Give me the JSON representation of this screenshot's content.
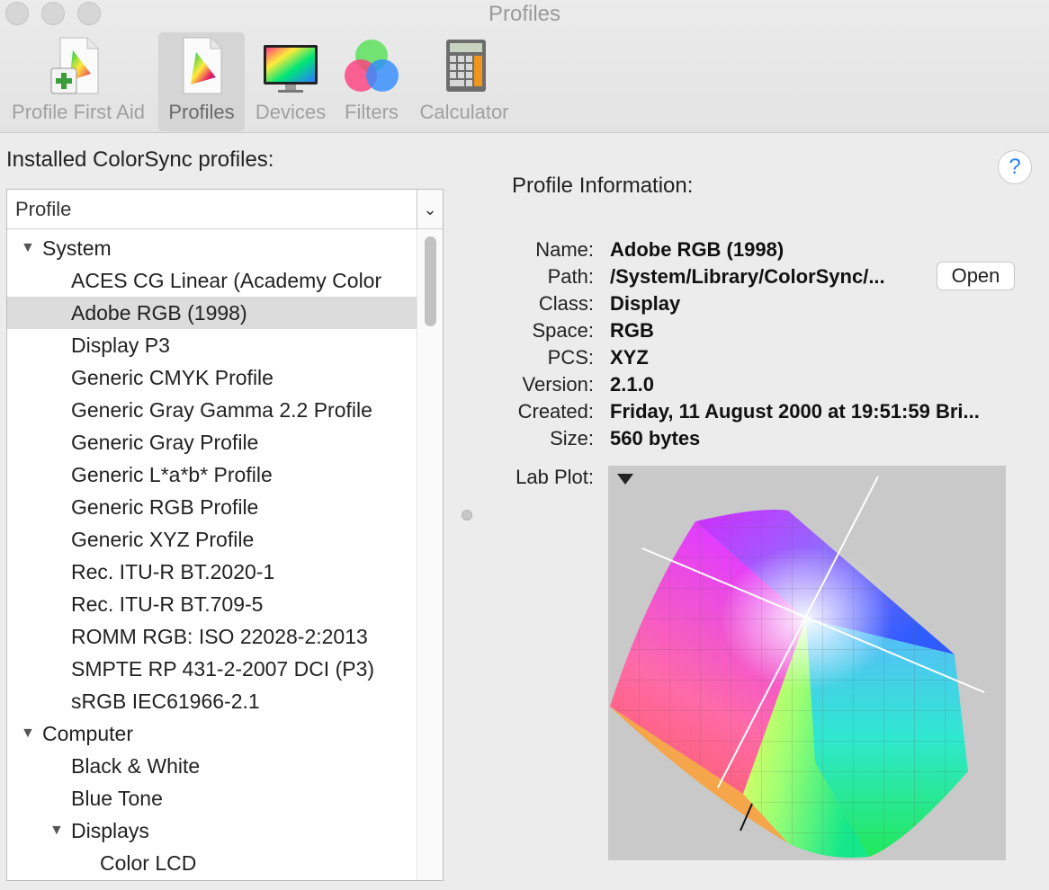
{
  "window": {
    "title": "Profiles"
  },
  "toolbar": {
    "items": [
      {
        "label": "Profile First Aid",
        "icon": "profile-first-aid-icon"
      },
      {
        "label": "Profiles",
        "icon": "profiles-icon",
        "active": true
      },
      {
        "label": "Devices",
        "icon": "devices-icon"
      },
      {
        "label": "Filters",
        "icon": "filters-icon"
      },
      {
        "label": "Calculator",
        "icon": "calculator-icon"
      }
    ]
  },
  "left": {
    "installed_label": "Installed ColorSync profiles:",
    "column_header": "Profile",
    "rows": [
      {
        "label": "System",
        "level": 0,
        "group": true,
        "expanded": true
      },
      {
        "label": "ACES CG Linear (Academy Color",
        "level": 1
      },
      {
        "label": "Adobe RGB (1998)",
        "level": 1,
        "selected": true
      },
      {
        "label": "Display P3",
        "level": 1
      },
      {
        "label": "Generic CMYK Profile",
        "level": 1
      },
      {
        "label": "Generic Gray Gamma 2.2 Profile",
        "level": 1
      },
      {
        "label": "Generic Gray Profile",
        "level": 1
      },
      {
        "label": "Generic L*a*b* Profile",
        "level": 1
      },
      {
        "label": "Generic RGB Profile",
        "level": 1
      },
      {
        "label": "Generic XYZ Profile",
        "level": 1
      },
      {
        "label": "Rec. ITU-R BT.2020-1",
        "level": 1
      },
      {
        "label": "Rec. ITU-R BT.709-5",
        "level": 1
      },
      {
        "label": "ROMM RGB: ISO 22028-2:2013",
        "level": 1
      },
      {
        "label": "SMPTE RP 431-2-2007 DCI (P3)",
        "level": 1
      },
      {
        "label": "sRGB IEC61966-2.1",
        "level": 1
      },
      {
        "label": "Computer",
        "level": 0,
        "group": true,
        "expanded": true
      },
      {
        "label": "Black & White",
        "level": 1
      },
      {
        "label": "Blue Tone",
        "level": 1
      },
      {
        "label": "Displays",
        "level": 1,
        "group": true,
        "expanded": true
      },
      {
        "label": "Color LCD",
        "level": 2
      }
    ]
  },
  "info": {
    "title": "Profile Information:",
    "help": "?",
    "open_label": "Open",
    "fields": [
      {
        "key": "Name:",
        "value": "Adobe RGB (1998)"
      },
      {
        "key": "Path:",
        "value": "/System/Library/ColorSync/..."
      },
      {
        "key": "Class:",
        "value": "Display"
      },
      {
        "key": "Space:",
        "value": "RGB"
      },
      {
        "key": "PCS:",
        "value": "XYZ"
      },
      {
        "key": "Version:",
        "value": "2.1.0"
      },
      {
        "key": "Created:",
        "value": "Friday, 11 August 2000 at 19:51:59 Bri..."
      },
      {
        "key": "Size:",
        "value": "560 bytes"
      }
    ],
    "lab_plot_label": "Lab Plot:"
  },
  "colors": {
    "selection": "#dcdcdc",
    "help_accent": "#2a7ff0"
  }
}
